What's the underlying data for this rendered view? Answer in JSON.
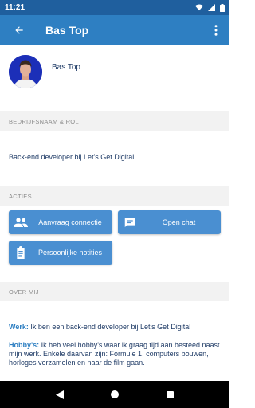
{
  "status_bar": {
    "time": "11:21"
  },
  "app_bar": {
    "title": "Bas Top"
  },
  "profile": {
    "name": "Bas Top"
  },
  "sections": {
    "company": {
      "header": "BEDRIJFSNAAM & ROL",
      "value": "Back-end developer bij Let's Get Digital"
    },
    "actions": {
      "header": "ACTIES",
      "buttons": [
        {
          "label": "Aanvraag connectie",
          "icon": "people-icon"
        },
        {
          "label": "Open chat",
          "icon": "chat-icon"
        },
        {
          "label": "Persoonlijke notities",
          "icon": "clipboard-icon"
        }
      ]
    },
    "about": {
      "header": "OVER MIJ",
      "work_label": "Werk:",
      "work_value": "Ik ben een back-end developer bij Let's Get Digital",
      "hobby_label": "Hobby's:",
      "hobby_value": "Ik heb veel hobby's waar ik graag tijd aan besteed naast mijn werk. Enkele daarvan zijn: Formule 1, computers bouwen, horloges verzamelen en naar de film gaan."
    }
  },
  "colors": {
    "primary": "#2e7fc2",
    "status_bar": "#1f5f9e",
    "button": "#4a8fd1",
    "text": "#1f3b66"
  }
}
